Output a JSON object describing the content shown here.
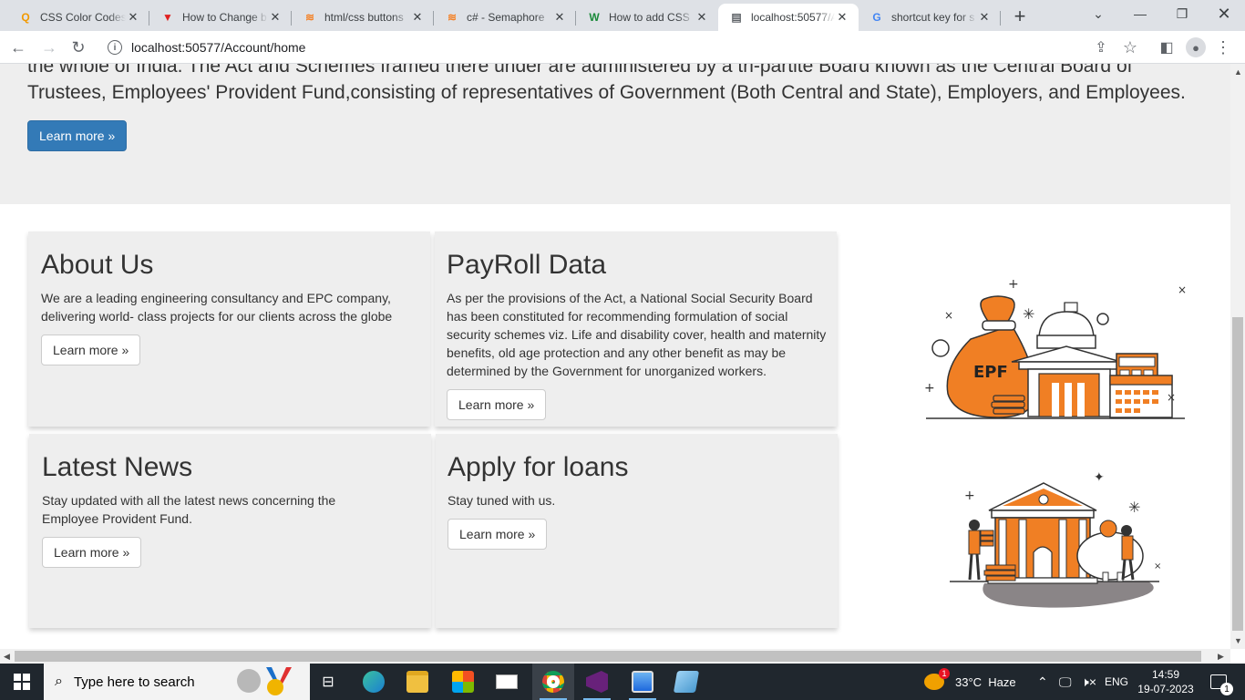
{
  "browser": {
    "tabs": [
      {
        "title": "CSS Color Codes",
        "favicon": "magnifier-orange-icon"
      },
      {
        "title": "How to Change b",
        "favicon": "v-red-icon"
      },
      {
        "title": "html/css buttons",
        "favicon": "stackoverflow-icon"
      },
      {
        "title": "c# - Semaphore",
        "favicon": "stackoverflow-icon"
      },
      {
        "title": "How to add CSS",
        "favicon": "w-green-icon"
      },
      {
        "title": "localhost:50577/A",
        "favicon": "page-icon"
      },
      {
        "title": "shortcut key for s",
        "favicon": "google-icon"
      }
    ],
    "url": "localhost:50577/Account/home"
  },
  "hero": {
    "text": "the whole of India. The Act and Schemes framed there under are administered by a tri-partite Board known as the Central Board of Trustees, Employees' Provident Fund,consisting of representatives of Government (Both Central and State), Employers, and Employees.",
    "button": "Learn more »"
  },
  "cards": {
    "about": {
      "title": "About Us",
      "text": "We are a leading engineering consultancy and EPC company, delivering world- class projects for our clients across the globe",
      "button": "Learn more »"
    },
    "payroll": {
      "title": "PayRoll Data",
      "text": "As per the provisions of the Act, a National Social Security Board has been constituted for recommending formulation of social security schemes viz. Life and disability cover, health and maternity benefits, old age protection and any other benefit as may be determined by the Government for unorganized workers.",
      "button": "Learn more »"
    },
    "news": {
      "title": "Latest News",
      "text": "Stay updated with all the latest news concerning the Employee Provident Fund.",
      "button": "Learn more »"
    },
    "loans": {
      "title": "Apply for loans",
      "text": "Stay tuned with us.",
      "button": "Learn more »"
    }
  },
  "illustration": {
    "epf_label": "EPF"
  },
  "colors": {
    "primary_button": "#337ab7",
    "card_bg": "#eeeeee",
    "illustration_orange": "#f07f24"
  },
  "taskbar": {
    "search_placeholder": "Type here to search",
    "weather": "33°C  Haze",
    "weather_badge": "1",
    "language": "ENG",
    "time": "14:59",
    "date": "19-07-2023",
    "notification_count": "1"
  }
}
